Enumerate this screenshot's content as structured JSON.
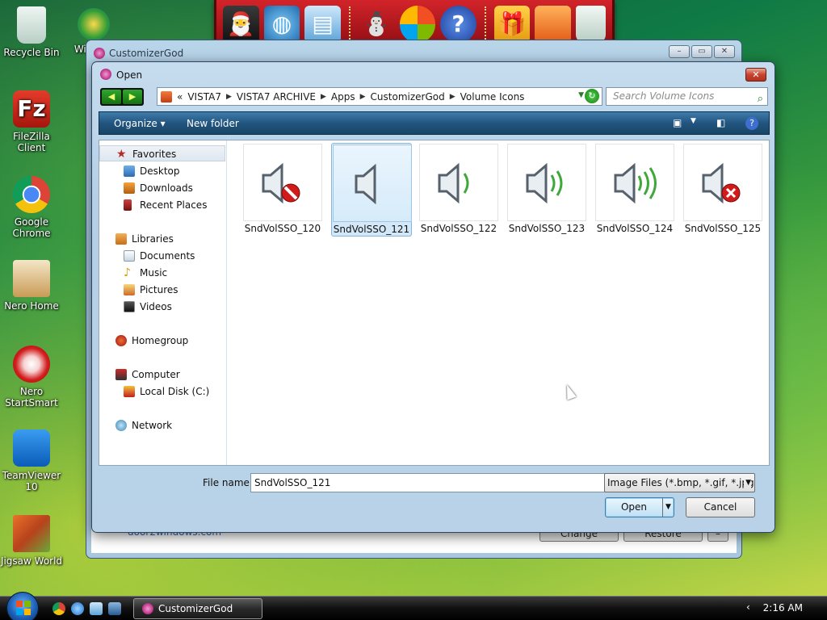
{
  "desktop": {
    "icons": [
      {
        "label": "Recycle Bin",
        "icon": "recycle-bin-icon"
      },
      {
        "label": "FileZilla Client",
        "icon": "filezilla-icon"
      },
      {
        "label": "Google Chrome",
        "icon": "chrome-icon"
      },
      {
        "label": "Nero Home",
        "icon": "nero-home-icon"
      },
      {
        "label": "Nero StartSmart",
        "icon": "nero-startsmart-icon"
      },
      {
        "label": "TeamViewer 10",
        "icon": "teamviewer-icon"
      },
      {
        "label": "Jigsaw World",
        "icon": "jigsaw-icon"
      }
    ],
    "partial_icon_label": "Wi... L..."
  },
  "dock": {
    "icons": [
      "santa-monitor-icon",
      "globe-monitor-icon",
      "desktop-window-icon",
      "snowman-icon",
      "windows-flag-icon",
      "help-icon",
      "gift-icon",
      "folder-icon",
      "trash-icon"
    ]
  },
  "background_window": {
    "title": "CustomizerGod",
    "link": "door2windows.com",
    "buttons": [
      "Change",
      "Restore",
      "–"
    ]
  },
  "dialog": {
    "title": "Open",
    "breadcrumb": [
      "VISTA7",
      "VISTA7 ARCHIVE",
      "Apps",
      "CustomizerGod",
      "Volume Icons"
    ],
    "breadcrumb_prefix": "«",
    "search_placeholder": "Search Volume Icons",
    "toolbar": {
      "organize": "Organize ▾",
      "new_folder": "New folder"
    },
    "nav": {
      "favorites": "Favorites",
      "desktop": "Desktop",
      "downloads": "Downloads",
      "recent_places": "Recent Places",
      "libraries": "Libraries",
      "documents": "Documents",
      "music": "Music",
      "pictures": "Pictures",
      "videos": "Videos",
      "homegroup": "Homegroup",
      "computer": "Computer",
      "local_disk": "Local Disk (C:)",
      "network": "Network"
    },
    "files": [
      {
        "name": "SndVolSSO_120",
        "icon": "speaker-blocked-icon",
        "selected": false
      },
      {
        "name": "SndVolSSO_121",
        "icon": "speaker-mute-icon",
        "selected": true
      },
      {
        "name": "SndVolSSO_122",
        "icon": "speaker-low-icon",
        "selected": false
      },
      {
        "name": "SndVolSSO_123",
        "icon": "speaker-medium-icon",
        "selected": false
      },
      {
        "name": "SndVolSSO_124",
        "icon": "speaker-high-icon",
        "selected": false
      },
      {
        "name": "SndVolSSO_125",
        "icon": "speaker-error-icon",
        "selected": false
      }
    ],
    "file_name_label": "File name:",
    "file_name_value": "SndVolSSO_121",
    "file_type": "Image Files (*.bmp, *.gif, *.jpg,",
    "open_button": "Open",
    "cancel_button": "Cancel"
  },
  "taskbar": {
    "active_app": "CustomizerGod",
    "clock": "2:16 AM"
  }
}
